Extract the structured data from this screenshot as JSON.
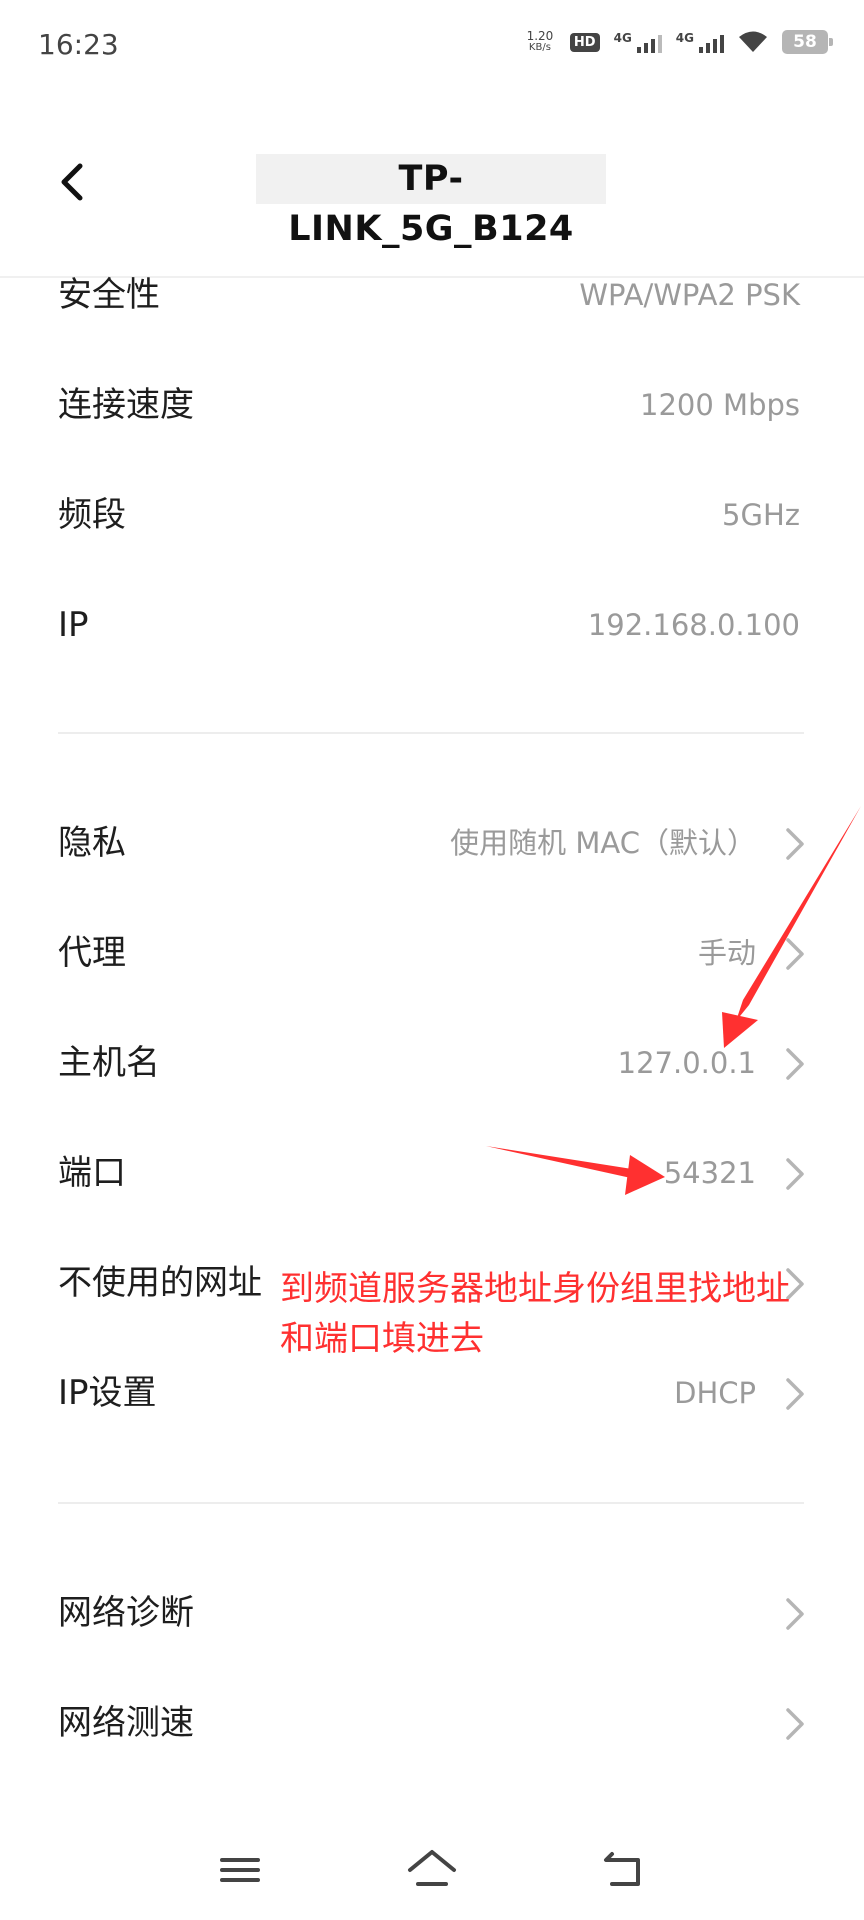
{
  "status_bar": {
    "time": "16:23",
    "net_speed_value": "1.20",
    "net_speed_unit": "KB/s",
    "hd_label": "HD",
    "sim1_label": "4G",
    "sim2_label": "4G",
    "battery": "58"
  },
  "header": {
    "title": "TP-LINK_5G_B124",
    "back_icon": "chevron-left-icon"
  },
  "info_section": [
    {
      "label": "安全性",
      "value": "WPA/WPA2 PSK"
    },
    {
      "label": "连接速度",
      "value": "1200 Mbps"
    },
    {
      "label": "频段",
      "value": "5GHz"
    },
    {
      "label": "IP",
      "value": "192.168.0.100"
    }
  ],
  "settings_section": [
    {
      "label": "隐私",
      "value": "使用随机 MAC（默认）"
    },
    {
      "label": "代理",
      "value": "手动"
    },
    {
      "label": "主机名",
      "value": "127.0.0.1"
    },
    {
      "label": "端口",
      "value": "54321"
    },
    {
      "label": "不使用的网址",
      "value": ""
    },
    {
      "label": "IP设置",
      "value": "DHCP"
    }
  ],
  "tools_section": [
    {
      "label": "网络诊断"
    },
    {
      "label": "网络测速"
    }
  ],
  "annotation": {
    "line1": "到频道服务器地址身份组里找地址",
    "line2": "和端口填进去",
    "color": "#ff3030"
  },
  "nav_bar": {
    "menu_icon": "menu-icon",
    "home_icon": "home-icon",
    "back_icon": "back-icon"
  }
}
